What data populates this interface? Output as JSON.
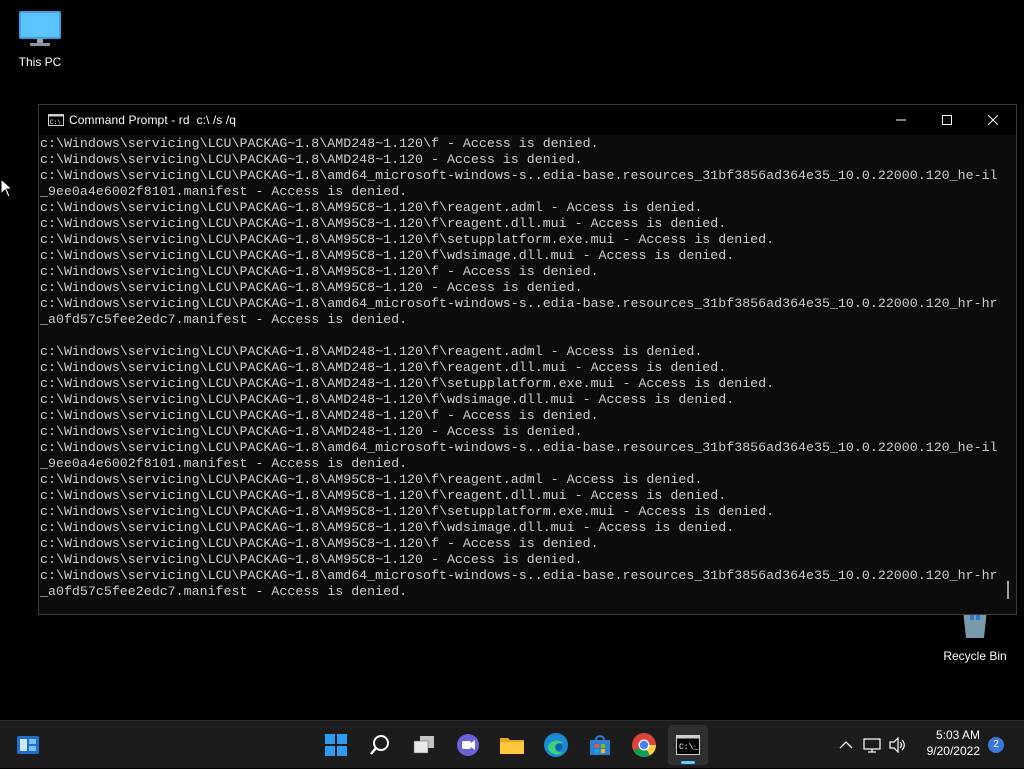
{
  "desktop": {
    "icons": [
      {
        "label": "This PC"
      },
      {
        "label": "Recycle Bin"
      }
    ]
  },
  "window": {
    "title": "Command Prompt - rd  c:\\ /s /q",
    "console_lines": [
      "c:\\Windows\\servicing\\LCU\\PACKAG~1.8\\AMD248~1.120\\f - Access is denied.",
      "c:\\Windows\\servicing\\LCU\\PACKAG~1.8\\AMD248~1.120 - Access is denied.",
      "c:\\Windows\\servicing\\LCU\\PACKAG~1.8\\amd64_microsoft-windows-s..edia-base.resources_31bf3856ad364e35_10.0.22000.120_he-il",
      "_9ee0a4e6002f8101.manifest - Access is denied.",
      "c:\\Windows\\servicing\\LCU\\PACKAG~1.8\\AM95C8~1.120\\f\\reagent.adml - Access is denied.",
      "c:\\Windows\\servicing\\LCU\\PACKAG~1.8\\AM95C8~1.120\\f\\reagent.dll.mui - Access is denied.",
      "c:\\Windows\\servicing\\LCU\\PACKAG~1.8\\AM95C8~1.120\\f\\setupplatform.exe.mui - Access is denied.",
      "c:\\Windows\\servicing\\LCU\\PACKAG~1.8\\AM95C8~1.120\\f\\wdsimage.dll.mui - Access is denied.",
      "c:\\Windows\\servicing\\LCU\\PACKAG~1.8\\AM95C8~1.120\\f - Access is denied.",
      "c:\\Windows\\servicing\\LCU\\PACKAG~1.8\\AM95C8~1.120 - Access is denied.",
      "c:\\Windows\\servicing\\LCU\\PACKAG~1.8\\amd64_microsoft-windows-s..edia-base.resources_31bf3856ad364e35_10.0.22000.120_hr-hr",
      "_a0fd57c5fee2edc7.manifest - Access is denied.",
      "",
      "c:\\Windows\\servicing\\LCU\\PACKAG~1.8\\AMD248~1.120\\f\\reagent.adml - Access is denied.",
      "c:\\Windows\\servicing\\LCU\\PACKAG~1.8\\AMD248~1.120\\f\\reagent.dll.mui - Access is denied.",
      "c:\\Windows\\servicing\\LCU\\PACKAG~1.8\\AMD248~1.120\\f\\setupplatform.exe.mui - Access is denied.",
      "c:\\Windows\\servicing\\LCU\\PACKAG~1.8\\AMD248~1.120\\f\\wdsimage.dll.mui - Access is denied.",
      "c:\\Windows\\servicing\\LCU\\PACKAG~1.8\\AMD248~1.120\\f - Access is denied.",
      "c:\\Windows\\servicing\\LCU\\PACKAG~1.8\\AMD248~1.120 - Access is denied.",
      "c:\\Windows\\servicing\\LCU\\PACKAG~1.8\\amd64_microsoft-windows-s..edia-base.resources_31bf3856ad364e35_10.0.22000.120_he-il",
      "_9ee0a4e6002f8101.manifest - Access is denied.",
      "c:\\Windows\\servicing\\LCU\\PACKAG~1.8\\AM95C8~1.120\\f\\reagent.adml - Access is denied.",
      "c:\\Windows\\servicing\\LCU\\PACKAG~1.8\\AM95C8~1.120\\f\\reagent.dll.mui - Access is denied.",
      "c:\\Windows\\servicing\\LCU\\PACKAG~1.8\\AM95C8~1.120\\f\\setupplatform.exe.mui - Access is denied.",
      "c:\\Windows\\servicing\\LCU\\PACKAG~1.8\\AM95C8~1.120\\f\\wdsimage.dll.mui - Access is denied.",
      "c:\\Windows\\servicing\\LCU\\PACKAG~1.8\\AM95C8~1.120\\f - Access is denied.",
      "c:\\Windows\\servicing\\LCU\\PACKAG~1.8\\AM95C8~1.120 - Access is denied.",
      "c:\\Windows\\servicing\\LCU\\PACKAG~1.8\\amd64_microsoft-windows-s..edia-base.resources_31bf3856ad364e35_10.0.22000.120_hr-hr",
      "_a0fd57c5fee2edc7.manifest - Access is denied."
    ]
  },
  "taskbar": {
    "apps": [
      "widgets-icon",
      "start-icon",
      "search-icon",
      "task-view-icon",
      "chat-icon",
      "file-explorer-icon",
      "edge-icon",
      "store-icon",
      "chrome-icon",
      "terminal-icon"
    ],
    "clock_time": "5:03 AM",
    "clock_date": "9/20/2022",
    "notification_count": "2"
  },
  "colors": {
    "console_bg": "#0c0c0c",
    "console_text": "#cccccc",
    "taskbar_bg": "#1c1c1c",
    "accent": "#60cdff"
  }
}
